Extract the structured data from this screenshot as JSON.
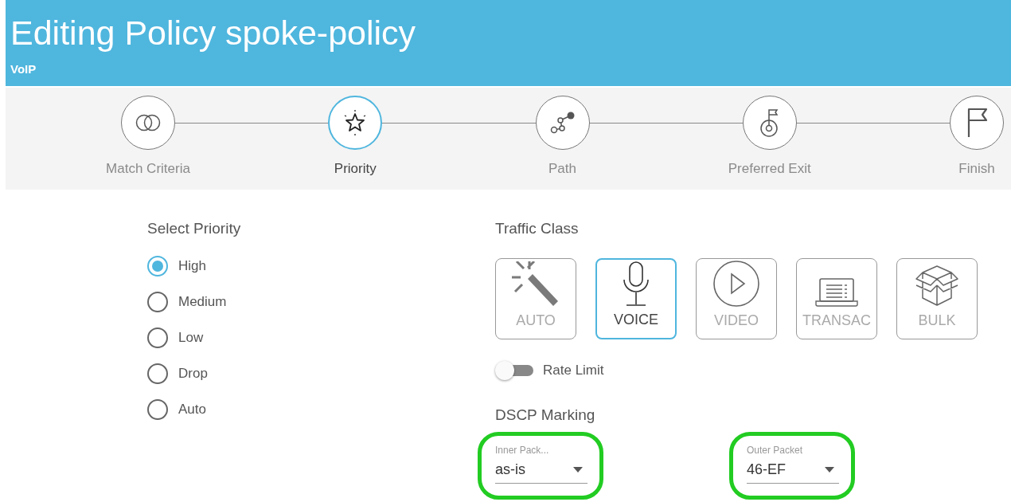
{
  "header": {
    "title": "Editing Policy spoke-policy",
    "subtitle": "VoIP"
  },
  "steps": [
    {
      "label": "Match Criteria",
      "kind": "match",
      "selected": false
    },
    {
      "label": "Priority",
      "kind": "priority",
      "selected": true
    },
    {
      "label": "Path",
      "kind": "path",
      "selected": false
    },
    {
      "label": "Preferred Exit",
      "kind": "exit",
      "selected": false
    },
    {
      "label": "Finish",
      "kind": "finish",
      "selected": false
    }
  ],
  "priority": {
    "heading": "Select Priority",
    "options": [
      {
        "label": "High",
        "selected": true
      },
      {
        "label": "Medium",
        "selected": false
      },
      {
        "label": "Low",
        "selected": false
      },
      {
        "label": "Drop",
        "selected": false
      },
      {
        "label": "Auto",
        "selected": false
      }
    ]
  },
  "traffic_class": {
    "heading": "Traffic Class",
    "classes": [
      {
        "label": "AUTO",
        "kind": "auto",
        "selected": false
      },
      {
        "label": "VOICE",
        "kind": "voice",
        "selected": true
      },
      {
        "label": "VIDEO",
        "kind": "video",
        "selected": false
      },
      {
        "label": "TRANSAC",
        "kind": "transac",
        "selected": false
      },
      {
        "label": "BULK",
        "kind": "bulk",
        "selected": false
      }
    ]
  },
  "rate_limit": {
    "label": "Rate Limit",
    "on": false
  },
  "dscp": {
    "heading": "DSCP Marking",
    "fields": [
      {
        "label": "Inner Pack...",
        "value": "as-is",
        "highlighted": true
      },
      {
        "label": "Outer Packet",
        "value": "46-EF",
        "highlighted": true
      }
    ]
  }
}
